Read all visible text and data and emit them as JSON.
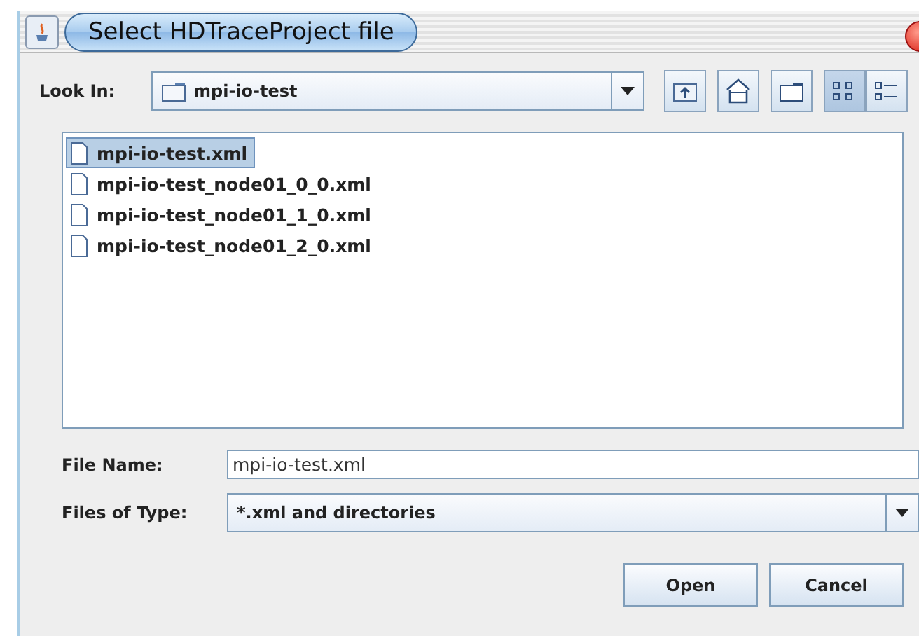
{
  "window": {
    "title": "Select HDTraceProject file"
  },
  "look_in": {
    "label": "Look In:",
    "value": "mpi-io-test"
  },
  "toolbar": [
    {
      "kind": "up",
      "selected": false
    },
    {
      "kind": "home",
      "selected": false
    },
    {
      "kind": "new-folder",
      "selected": false
    },
    {
      "kind": "list",
      "selected": true
    },
    {
      "kind": "details",
      "selected": false
    }
  ],
  "files": [
    {
      "name": "mpi-io-test.xml",
      "selected": true
    },
    {
      "name": "mpi-io-test_node01_0_0.xml",
      "selected": false
    },
    {
      "name": "mpi-io-test_node01_1_0.xml",
      "selected": false
    },
    {
      "name": "mpi-io-test_node01_2_0.xml",
      "selected": false
    }
  ],
  "file_name": {
    "label": "File Name:",
    "value": "mpi-io-test.xml"
  },
  "file_type": {
    "label": "Files of Type:",
    "value": "*.xml and directories"
  },
  "buttons": [
    "Open",
    "Cancel"
  ]
}
